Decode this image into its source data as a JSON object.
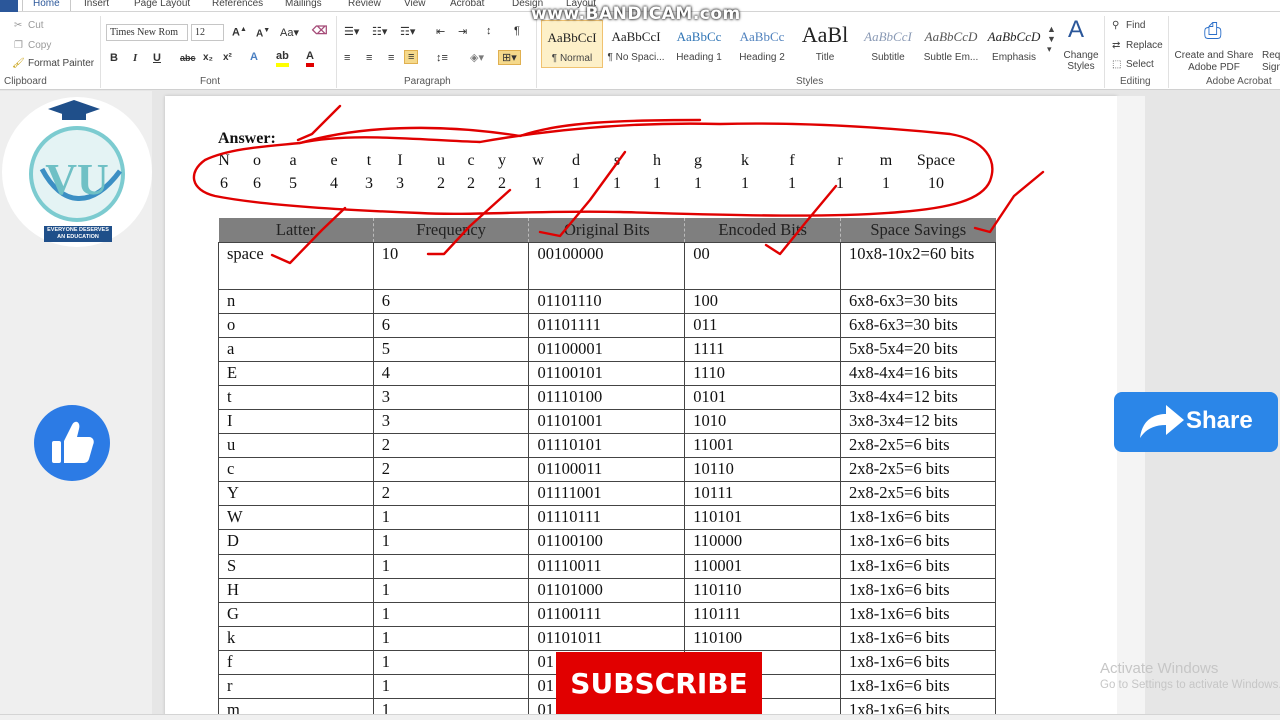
{
  "watermark": "www.BANDICAM.com",
  "ribbon": {
    "tabs": [
      "Home",
      "Insert",
      "Page Layout",
      "References",
      "Mailings",
      "Review",
      "View",
      "Acrobat",
      "Design",
      "Layout"
    ],
    "clipboard": {
      "cut": "Cut",
      "copy": "Copy",
      "format_painter": "Format Painter",
      "label": "Clipboard"
    },
    "font": {
      "name": "Times New Rom",
      "size": "12",
      "label": "Font"
    },
    "paragraph": {
      "label": "Paragraph"
    },
    "styles": {
      "label": "Styles",
      "items": [
        {
          "sample": "AaBbCcI",
          "name": "¶ Normal",
          "color": "#222222"
        },
        {
          "sample": "AaBbCcI",
          "name": "¶ No Spaci...",
          "color": "#222222"
        },
        {
          "sample": "AaBbCc",
          "name": "Heading 1",
          "color": "#2e74b5"
        },
        {
          "sample": "AaBbCc",
          "name": "Heading 2",
          "color": "#4f81bd"
        },
        {
          "sample": "AaBl",
          "name": "Title",
          "color": "#222222"
        },
        {
          "sample": "AaBbCcI",
          "name": "Subtitle",
          "color": "#8a9ab5"
        },
        {
          "sample": "AaBbCcD",
          "name": "Subtle Em...",
          "color": "#555555"
        },
        {
          "sample": "AaBbCcD",
          "name": "Emphasis",
          "color": "#222222"
        }
      ],
      "change_styles": "Change Styles"
    },
    "editing": {
      "find": "Find",
      "replace": "Replace",
      "select": "Select",
      "label": "Editing"
    },
    "acrobat": {
      "create_pdf": "Create and Share Adobe PDF",
      "request_sign": "Req Sign",
      "label": "Adobe Acrobat"
    }
  },
  "document": {
    "answer_label": "Answer:",
    "chars": [
      "N",
      "o",
      "a",
      "e",
      "t",
      "I",
      "u",
      "c",
      "y",
      "w",
      "d",
      "s",
      "h",
      "g",
      "k",
      "f",
      "r",
      "m",
      "Space"
    ],
    "counts": [
      "6",
      "6",
      "5",
      "4",
      "3",
      "3",
      "2",
      "2",
      "2",
      "1",
      "1",
      "1",
      "1",
      "1",
      "1",
      "1",
      "1",
      "1",
      "10"
    ],
    "table": {
      "headers": [
        "Latter",
        "Frequency",
        "Original Bits",
        "Encoded Bits",
        "Space Savings"
      ],
      "rows": [
        [
          "space",
          "10",
          "00100000",
          "00",
          "10x8-10x2=60 bits"
        ],
        [
          "n",
          "6",
          "01101110",
          "100",
          "6x8-6x3=30 bits"
        ],
        [
          "o",
          "6",
          "01101111",
          "011",
          "6x8-6x3=30 bits"
        ],
        [
          "a",
          "5",
          "01100001",
          "1111",
          "5x8-5x4=20 bits"
        ],
        [
          "E",
          "4",
          "01100101",
          "1110",
          "4x8-4x4=16 bits"
        ],
        [
          "t",
          "3",
          "01110100",
          "0101",
          "3x8-4x4=12 bits"
        ],
        [
          "I",
          "3",
          "01101001",
          "1010",
          "3x8-3x4=12 bits"
        ],
        [
          "u",
          "2",
          "01110101",
          "11001",
          "2x8-2x5=6 bits"
        ],
        [
          "c",
          "2",
          "01100011",
          "10110",
          "2x8-2x5=6 bits"
        ],
        [
          "Y",
          "2",
          "01111001",
          "10111",
          "2x8-2x5=6 bits"
        ],
        [
          "W",
          "1",
          "01110111",
          "110101",
          "1x8-1x6=6 bits"
        ],
        [
          "D",
          "1",
          "01100100",
          "110000",
          "1x8-1x6=6 bits"
        ],
        [
          "S",
          "1",
          "01110011",
          "110001",
          "1x8-1x6=6 bits"
        ],
        [
          "H",
          "1",
          "01101000",
          "110110",
          "1x8-1x6=6 bits"
        ],
        [
          "G",
          "1",
          "01100111",
          "110111",
          "1x8-1x6=6 bits"
        ],
        [
          "k",
          "1",
          "01101011",
          "110100",
          "1x8-1x6=6 bits"
        ],
        [
          "f",
          "1",
          "01",
          "",
          "1x8-1x6=6 bits"
        ],
        [
          "r",
          "1",
          "01",
          "",
          "1x8-1x6=6 bits"
        ],
        [
          "m",
          "1",
          "01",
          "",
          "1x8-1x6=6 bits"
        ]
      ]
    }
  },
  "overlays": {
    "logo_text": "EVERYONE DESERVES AN EDUCATION",
    "share": "Share",
    "subscribe": "SUBSCRIBE",
    "activate_title": "Activate Windows",
    "activate_sub": "Go to Settings to activate Windows."
  }
}
